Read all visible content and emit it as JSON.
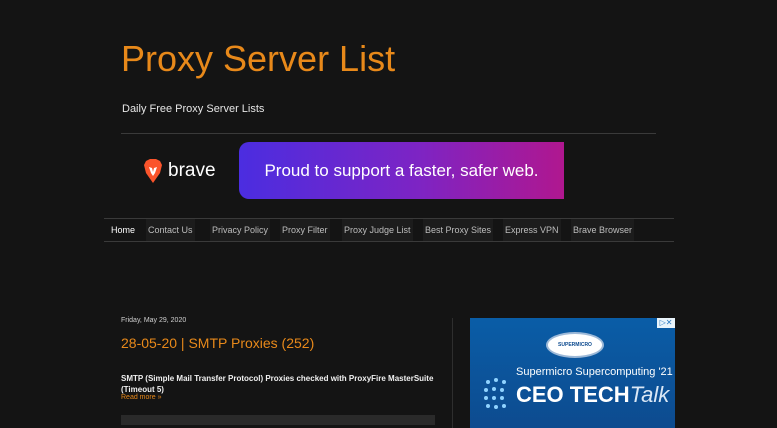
{
  "header": {
    "title": "Proxy Server List",
    "tagline": "Daily Free Proxy Server Lists"
  },
  "banner": {
    "brand": "brave",
    "message": "Proud to support a faster, safer web.",
    "colors": {
      "gradient_start": "#4b2de0",
      "gradient_end": "#b0178f",
      "lion": "#fb542b"
    }
  },
  "nav": {
    "items": [
      {
        "label": "Home"
      },
      {
        "label": "Contact Us"
      },
      {
        "label": "Privacy Policy"
      },
      {
        "label": "Proxy Filter"
      },
      {
        "label": "Proxy Judge List"
      },
      {
        "label": "Best Proxy Sites"
      },
      {
        "label": "Express VPN"
      },
      {
        "label": "Brave Browser"
      }
    ]
  },
  "post": {
    "date": "Friday, May 29, 2020",
    "title": "28-05-20 | SMTP Proxies (252)",
    "body": "SMTP (Simple Mail Transfer Protocol) Proxies checked with ProxyFire MasterSuite (Timeout 5)",
    "read_more": "Read more »"
  },
  "ad": {
    "logo_text": "SUPERMICRO",
    "subtitle": "Supermicro Supercomputing '21",
    "headline_main": "CEO TECH",
    "headline_talk": "Talk",
    "close_icon": "ad-choices-icon"
  },
  "colors": {
    "accent": "#e8891a",
    "background": "#141414"
  }
}
